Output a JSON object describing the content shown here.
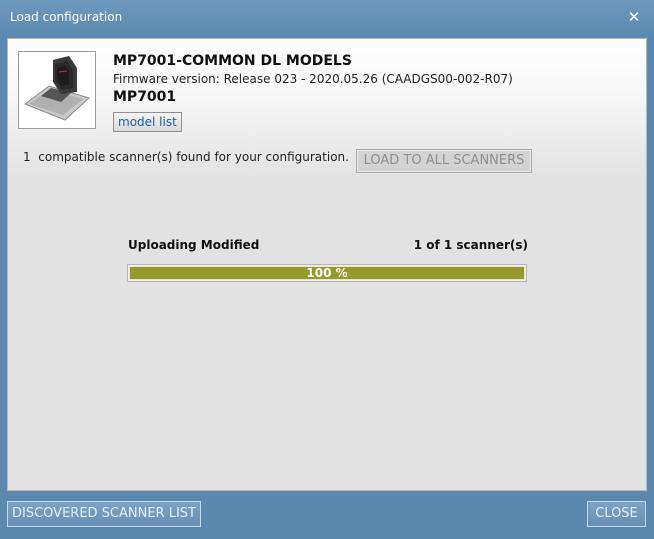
{
  "window": {
    "title": "Load configuration",
    "close_glyph": "✕"
  },
  "product": {
    "name": "MP7001-COMMON DL MODELS",
    "firmware": "Firmware version: Release 023 - 2020.05.26 (CAADGS00-002-R07)",
    "model": "MP7001",
    "model_list_label": "model list",
    "image_icon": "scanner-scale-image"
  },
  "scan": {
    "count": "1",
    "found_text": "compatible scanner(s) found for your configuration.",
    "load_all_label": "LOAD TO ALL SCANNERS"
  },
  "upload": {
    "label": "Uploading Modified",
    "count_text": "1 of 1 scanner(s)",
    "progress_percent": 100,
    "progress_text": "100 %"
  },
  "footer": {
    "discovered_label": "DISCOVERED SCANNER LIST",
    "close_label": "CLOSE"
  },
  "colors": {
    "titlebar": "#5a88af",
    "progress_fill": "#969a2c",
    "content_bg": "#e2e2e2"
  }
}
